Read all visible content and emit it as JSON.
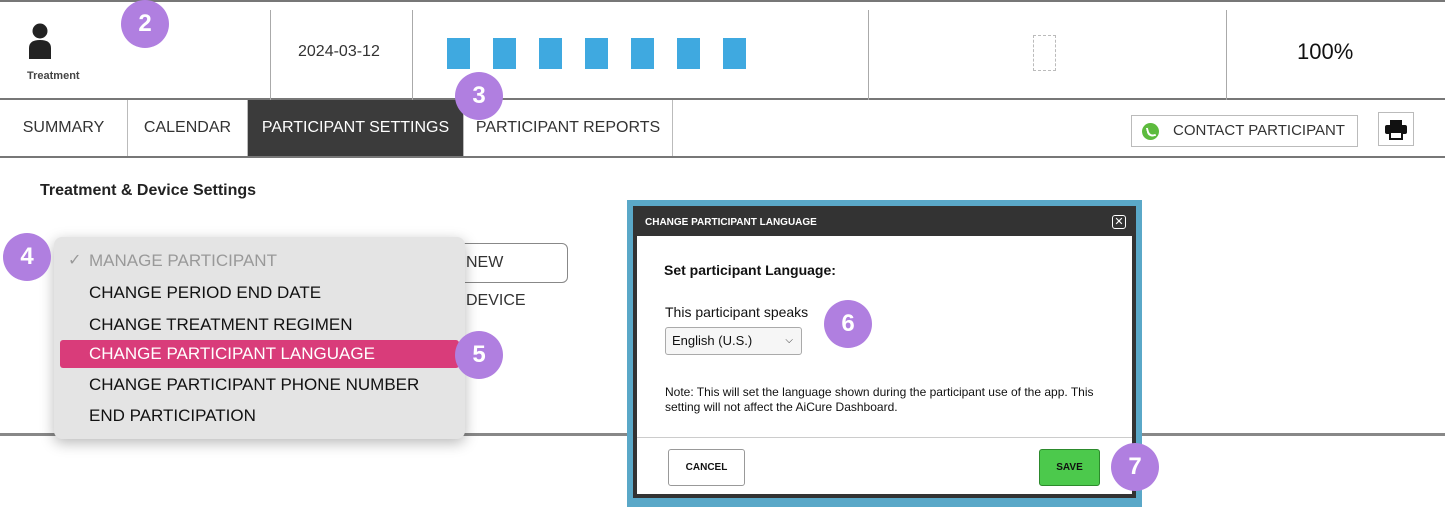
{
  "header": {
    "person_label": "Treatment",
    "date": "2024-03-12",
    "progress_squares": 7,
    "percent": "100%"
  },
  "tabs": [
    {
      "label": "SUMMARY",
      "active": false
    },
    {
      "label": "CALENDAR",
      "active": false
    },
    {
      "label": "PARTICIPANT SETTINGS",
      "active": true
    },
    {
      "label": "PARTICIPANT REPORTS",
      "active": false
    }
  ],
  "contact_button": "CONTACT PARTICIPANT",
  "section_title": "Treatment & Device Settings",
  "new_device_button": "NEW DEVICE",
  "menu": {
    "items": [
      {
        "label": "MANAGE PARTICIPANT",
        "checked": true
      },
      {
        "label": "CHANGE PERIOD END DATE"
      },
      {
        "label": "CHANGE TREATMENT REGIMEN"
      },
      {
        "label": "CHANGE PARTICIPANT LANGUAGE",
        "selected": true
      },
      {
        "label": "CHANGE PARTICIPANT PHONE NUMBER"
      },
      {
        "label": "END PARTICIPATION"
      }
    ]
  },
  "modal": {
    "title": "CHANGE PARTICIPANT LANGUAGE",
    "subtitle": "Set participant Language:",
    "speaks_label": "This participant speaks",
    "language_value": "English (U.S.)",
    "note": "Note: This will set the language shown during the participant use of the app. This setting will not affect the AiCure Dashboard.",
    "cancel_label": "CANCEL",
    "save_label": "SAVE"
  },
  "badges": [
    "2",
    "3",
    "4",
    "5",
    "6",
    "7"
  ],
  "colors": {
    "accent_blue": "#3fa9e0",
    "menu_highlight": "#d93c7a",
    "badge_purple": "#b07fe0",
    "save_green": "#4cc94c",
    "active_tab": "#3b3b3b"
  }
}
